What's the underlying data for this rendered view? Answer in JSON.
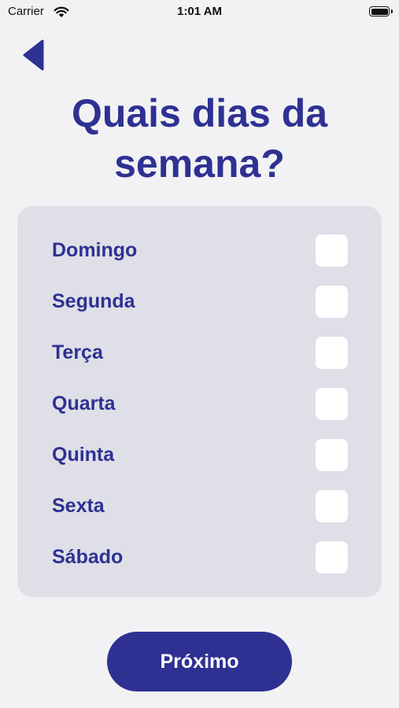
{
  "status_bar": {
    "carrier": "Carrier",
    "time": "1:01 AM",
    "wifi_icon": "wifi-icon",
    "battery_icon": "battery-icon"
  },
  "header": {
    "back_icon": "back-arrow-icon",
    "title": "Quais dias da\nsemana?"
  },
  "days": [
    {
      "label": "Domingo",
      "checked": false
    },
    {
      "label": "Segunda",
      "checked": false
    },
    {
      "label": "Terça",
      "checked": false
    },
    {
      "label": "Quarta",
      "checked": false
    },
    {
      "label": "Quinta",
      "checked": false
    },
    {
      "label": "Sexta",
      "checked": false
    },
    {
      "label": "Sábado",
      "checked": false
    }
  ],
  "footer": {
    "next_label": "Próximo"
  },
  "colors": {
    "accent": "#2e3192",
    "background": "#f2f2f4",
    "card": "#dfdfe8",
    "checkbox": "#ffffff"
  }
}
